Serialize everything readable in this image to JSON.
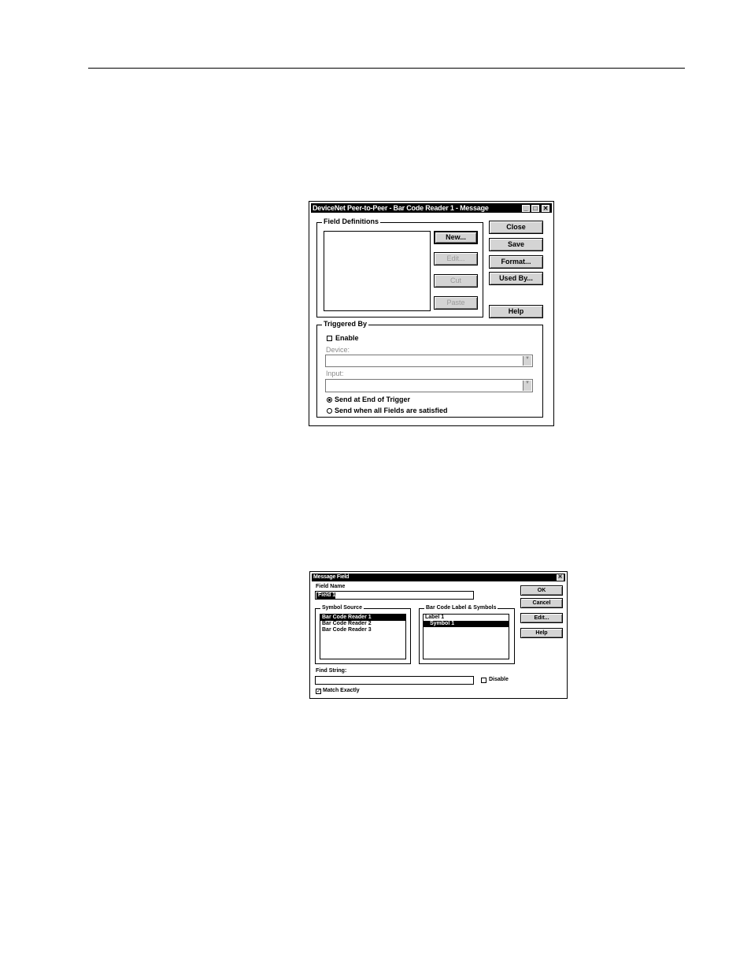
{
  "dialog1": {
    "title": "DeviceNet Peer-to-Peer - Bar Code Reader 1 - Message",
    "field_definitions": "Field Definitions",
    "buttons": {
      "new": "New...",
      "edit": "Edit...",
      "cut": "Cut",
      "paste": "Paste",
      "close": "Close",
      "save": "Save",
      "format": "Format...",
      "used_by": "Used By...",
      "help": "Help"
    },
    "triggered_by": "Triggered By",
    "enable": "Enable",
    "device_label": "Device:",
    "input_label": "Input:",
    "send_end": "Send at End of Trigger",
    "send_all": "Send when all Fields are satisfied"
  },
  "dialog2": {
    "title": "Message Field",
    "field_name_label": "Field Name",
    "field_name_value": "Field 1",
    "symbol_source": "Symbol Source",
    "sources": [
      "Bar Code Reader 1",
      "Bar Code Reader 2",
      "Bar Code Reader 3"
    ],
    "bar_code_label": "Bar Code Label & Symbols",
    "symbols": [
      "Label 1",
      "Symbol 1"
    ],
    "find_string_label": "Find String:",
    "disable": "Disable",
    "match_exactly": "Match Exactly",
    "buttons": {
      "ok": "OK",
      "cancel": "Cancel",
      "edit": "Edit...",
      "help": "Help"
    }
  }
}
